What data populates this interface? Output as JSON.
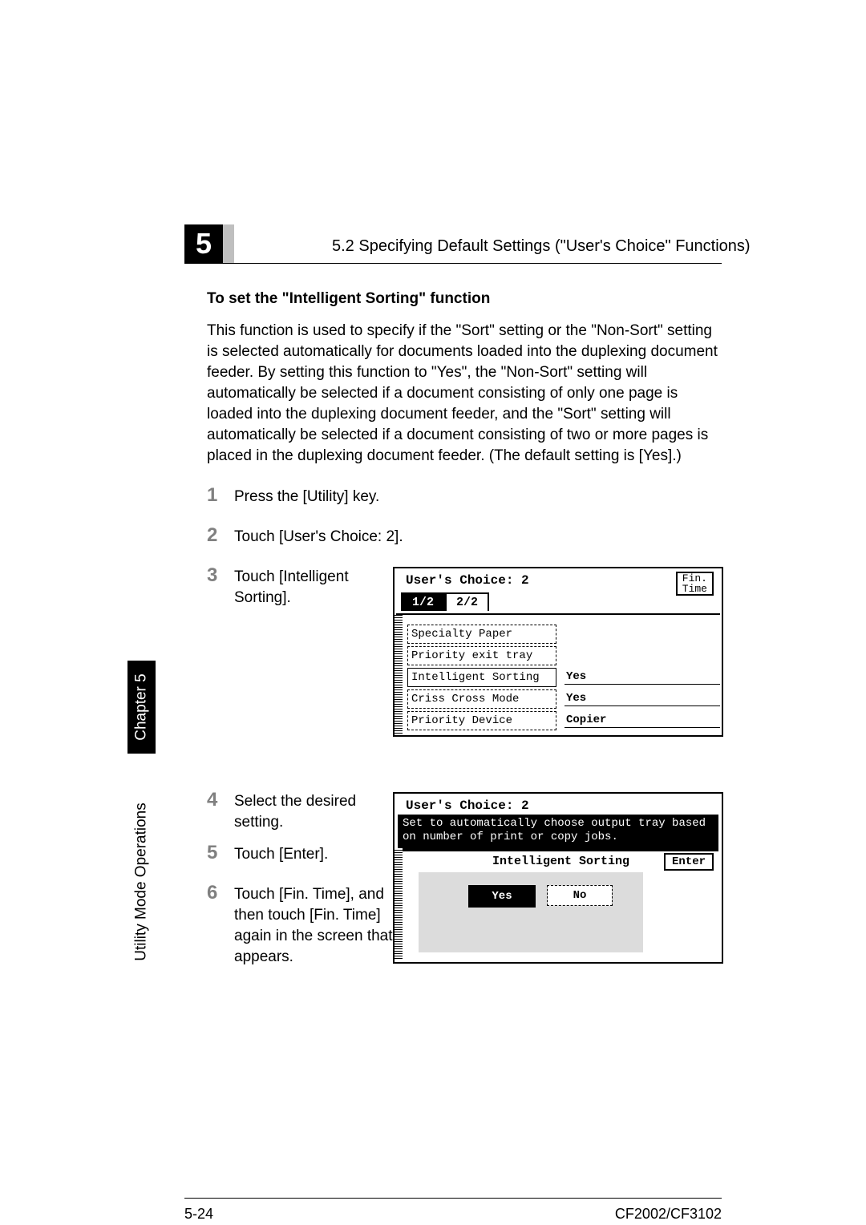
{
  "chapter_badge": "5",
  "header": "5.2 Specifying Default Settings (\"User's Choice\" Functions)",
  "subheading": "To set the \"Intelligent Sorting\" function",
  "paragraph": "This function is used to specify if the \"Sort\" setting or the \"Non-Sort\" setting is selected automatically for documents loaded into the duplexing document feeder. By setting this function to \"Yes\", the \"Non-Sort\" setting will automatically be selected if a document consisting of only one page is loaded into the duplexing document feeder, and the \"Sort\" setting will automatically be selected if a document consisting of two or more pages is placed in the duplexing document feeder. (The default setting is [Yes].)",
  "steps": {
    "s1": "Press the [Utility] key.",
    "s2": "Touch [User's Choice: 2].",
    "s3": "Touch [Intelligent Sorting].",
    "s4": "Select the desired setting.",
    "s5": "Touch [Enter].",
    "s6": "Touch [Fin. Time], and then touch [Fin. Time] again in the screen that appears."
  },
  "sidetab": {
    "chapter": "Chapter 5",
    "section": "Utility Mode Operations"
  },
  "lcd1": {
    "title": "User's Choice: 2",
    "fin1": "Fin.",
    "fin2": "Time",
    "tab1": "1/2",
    "tab2": "2/2",
    "rows": [
      {
        "label": "Specialty Paper",
        "value": ""
      },
      {
        "label": "Priority exit tray",
        "value": ""
      },
      {
        "label": "Intelligent Sorting",
        "value": "Yes"
      },
      {
        "label": "Criss Cross Mode",
        "value": "Yes"
      },
      {
        "label": "Priority Device",
        "value": "Copier"
      }
    ]
  },
  "lcd2": {
    "title": "User's Choice: 2",
    "banner": "Set to automatically choose output tray based on number of print or copy jobs.",
    "subtitle": "Intelligent Sorting",
    "enter": "Enter",
    "yes": "Yes",
    "no": "No"
  },
  "footer": {
    "left": "5-24",
    "right": "CF2002/CF3102"
  }
}
